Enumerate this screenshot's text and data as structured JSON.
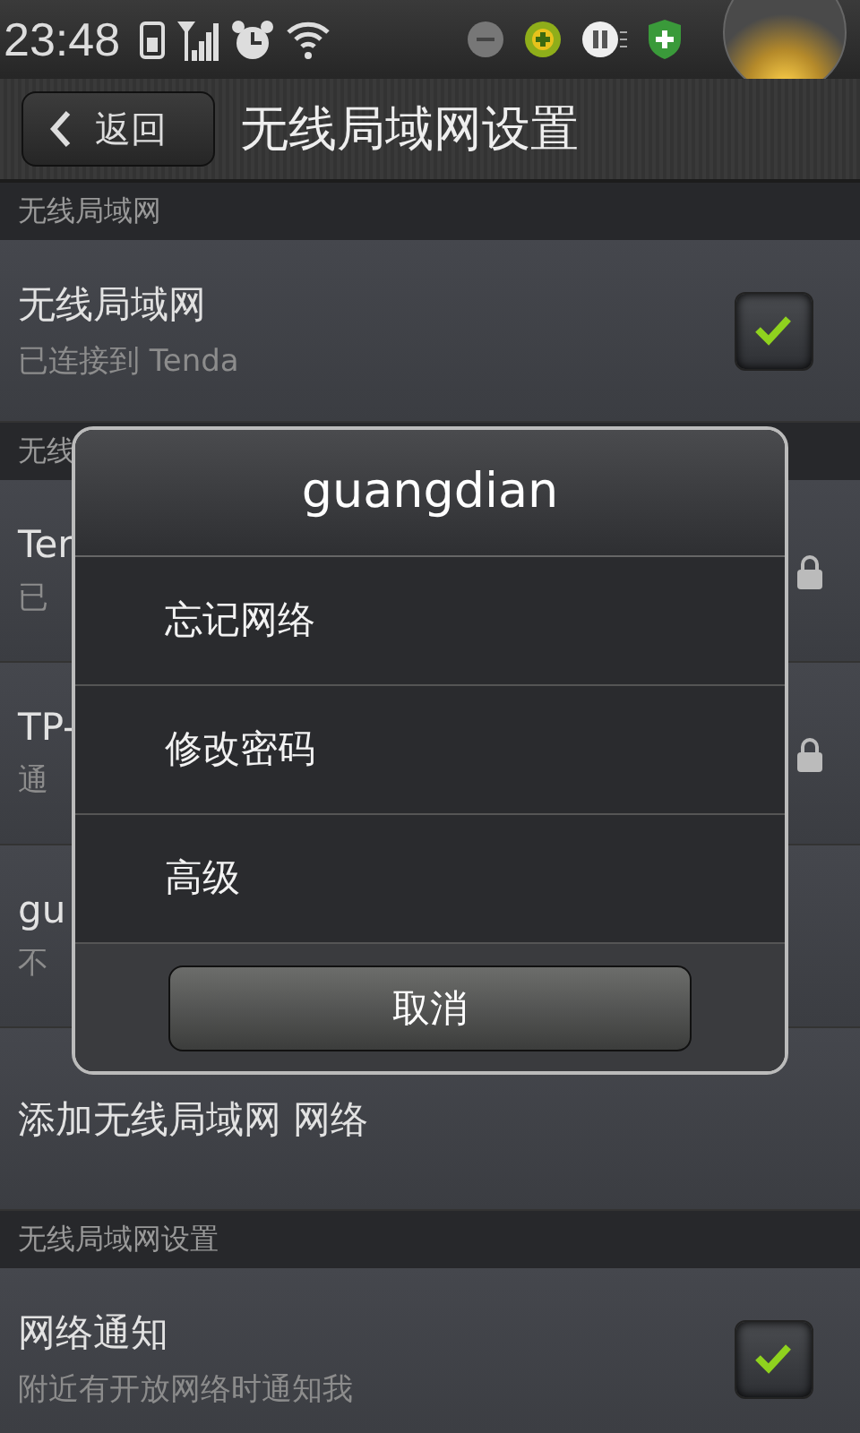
{
  "status_bar": {
    "time": "23:48"
  },
  "header": {
    "back": "返回",
    "title": "无线局域网设置"
  },
  "sections": [
    {
      "header": "无线局域网",
      "items": [
        {
          "kind": "toggle",
          "title": "无线局域网",
          "subtitle": "已连接到 Tenda",
          "checked": true
        }
      ]
    },
    {
      "header": "无线",
      "items": [
        {
          "kind": "network",
          "title": "Ten",
          "subtitle": "已",
          "locked": true
        },
        {
          "kind": "network",
          "title": "TP-",
          "subtitle": "通",
          "locked": true
        },
        {
          "kind": "network",
          "title": "gu",
          "subtitle": "不"
        },
        {
          "kind": "action",
          "title": "添加无线局域网 网络"
        }
      ]
    },
    {
      "header": "无线局域网设置",
      "items": [
        {
          "kind": "toggle",
          "title": "网络通知",
          "subtitle": "附近有开放网络时通知我",
          "checked": true
        }
      ]
    }
  ],
  "dialog": {
    "title": "guangdian",
    "options": [
      "忘记网络",
      "修改密码",
      "高级"
    ],
    "cancel": "取消"
  }
}
